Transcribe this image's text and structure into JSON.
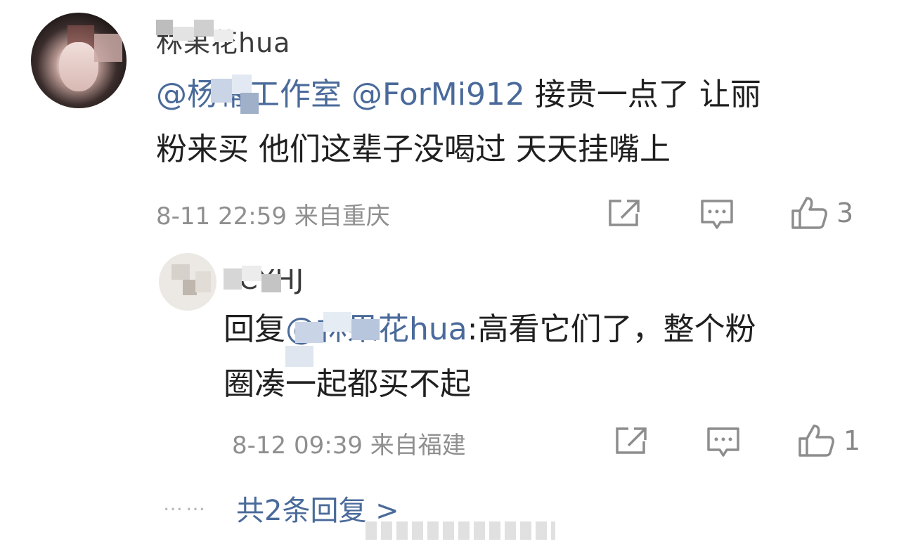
{
  "comment": {
    "username": "林果花hua",
    "mention_studio": "@杨幂工作室",
    "mention_user": "@ForMi912",
    "text_line1": " 接贵一点了 让丽",
    "text_line2": "粉来买 他们这辈子没喝过 天天挂嘴上",
    "timestamp": "8-11 22:59",
    "location": "来自重庆",
    "like_count": "3"
  },
  "reply": {
    "username": "YCYHJ",
    "prefix": "回复",
    "mention": "@林果花hua",
    "text_line1": ":高看它们了，整个粉",
    "text_line2": "圈凑一起都买不起",
    "timestamp": "8-12 09:39",
    "location": "来自福建",
    "like_count": "1"
  },
  "more": {
    "dots": "……",
    "label": "共2条回复 >"
  },
  "icons": {
    "share": "share-icon",
    "comment": "comment-icon",
    "like": "thumbs-up-icon"
  },
  "colors": {
    "mention": "#4a6a9a",
    "meta": "#8f8f8f",
    "text": "#1f1f1f"
  }
}
